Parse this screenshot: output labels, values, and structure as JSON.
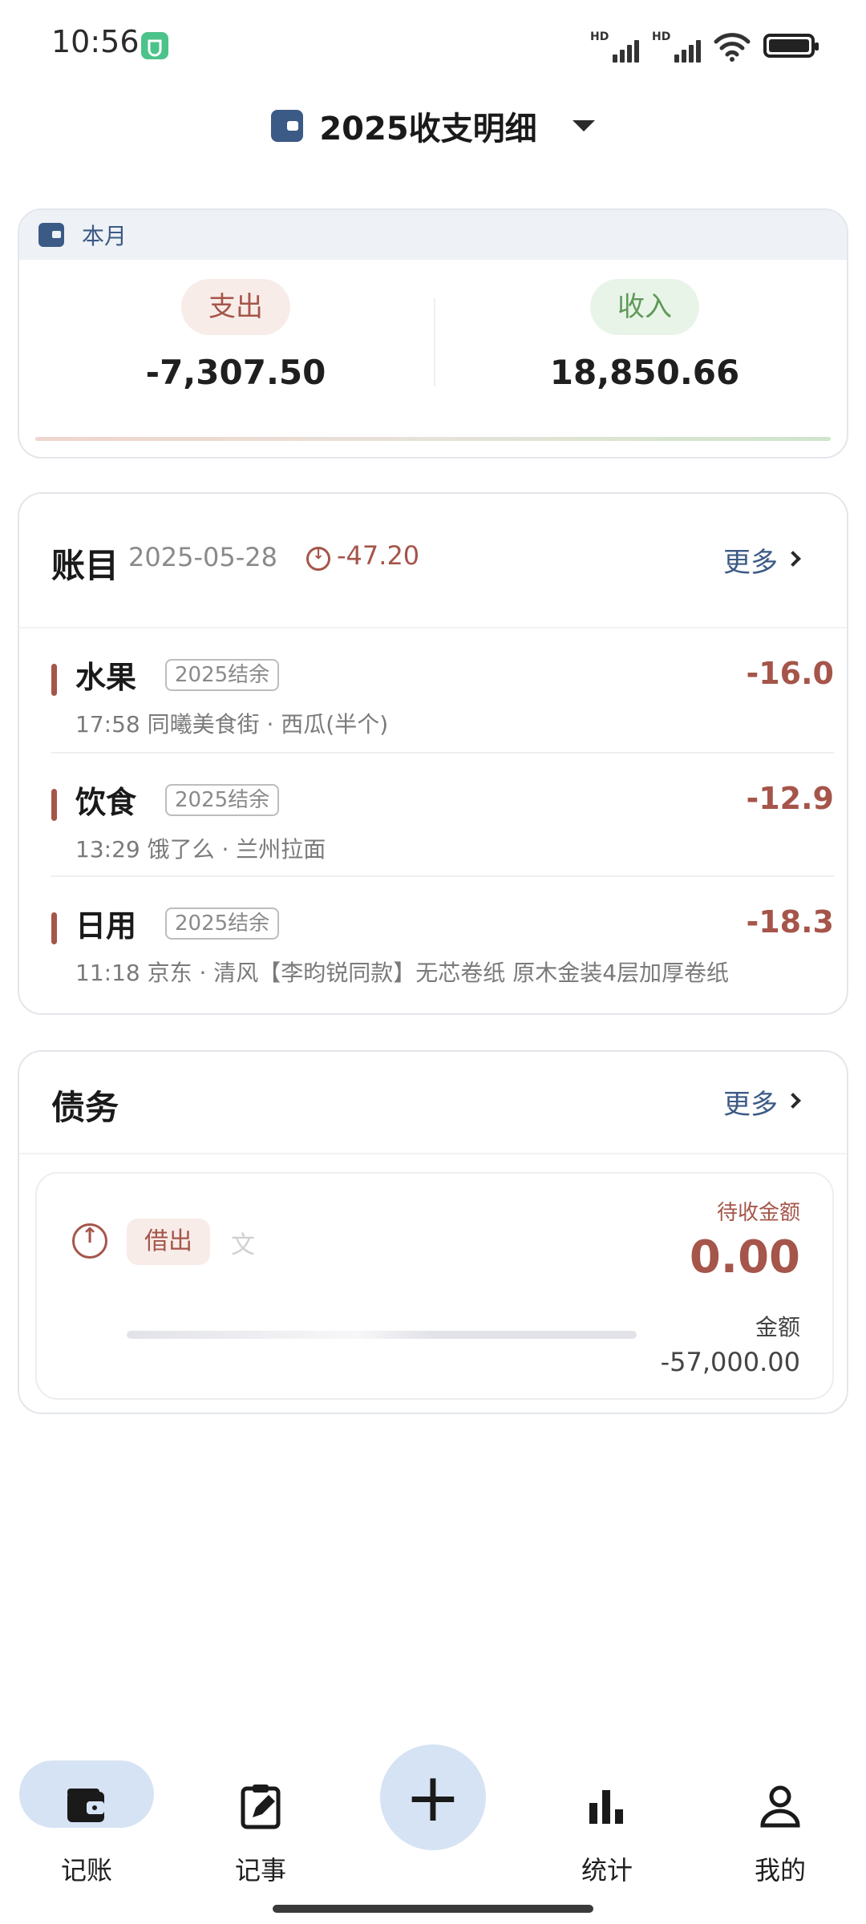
{
  "status_bar": {
    "time": "10:56",
    "signal_1_label": "HD",
    "signal_2_label": "HD",
    "icons": [
      "app-notification-icon",
      "hd-signal-icon",
      "wifi-icon",
      "battery-icon"
    ]
  },
  "header": {
    "title": "2025收支明细",
    "icon": "wallet-icon",
    "dropdown_icon": "caret-down-icon"
  },
  "month_summary": {
    "label": "本月",
    "expense_label": "支出",
    "expense_value": "-7,307.50",
    "income_label": "收入",
    "income_value": "18,850.66"
  },
  "ledger": {
    "title": "账目",
    "date": "2025-05-28",
    "day_total": "-47.20",
    "more_label": "更多",
    "entries": [
      {
        "category": "水果",
        "tag": "2025结余",
        "amount": "-16.0",
        "meta": "17:58  同曦美食街  ·  西瓜(半个)"
      },
      {
        "category": "饮食",
        "tag": "2025结余",
        "amount": "-12.9",
        "meta": "13:29  饿了么  ·  兰州拉面"
      },
      {
        "category": "日用",
        "tag": "2025结余",
        "amount": "-18.3",
        "meta": "11:18  京东  ·  清风【李昀锐同款】无芯卷纸 原木金装4层加厚卷纸"
      }
    ]
  },
  "debt": {
    "title": "债务",
    "more_label": "更多",
    "type_label": "借出",
    "name_partial": "文",
    "receivable_label": "待收金额",
    "receivable_value": "0.00",
    "amount_label": "金额",
    "amount_value": "-57,000.00"
  },
  "bottom_nav": {
    "items": [
      {
        "label": "记账",
        "icon": "wallet-icon",
        "active": true
      },
      {
        "label": "记事",
        "icon": "clipboard-edit-icon",
        "active": false
      },
      {
        "label": "统计",
        "icon": "bar-chart-icon",
        "active": false
      },
      {
        "label": "我的",
        "icon": "person-icon",
        "active": false
      }
    ],
    "fab_label": "+"
  },
  "colors": {
    "accent_blue": "#3c5a86",
    "expense_red": "#a5554a",
    "income_green": "#5e9a58",
    "nav_active": "#d6e3f4"
  }
}
